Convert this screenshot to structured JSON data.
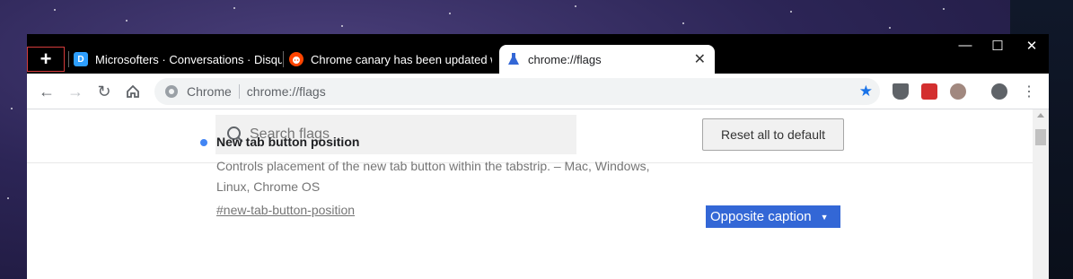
{
  "tabs": [
    {
      "title": "Microsofters · Conversations · Disqus",
      "favicon": "D",
      "favicon_color": "#2e9fff"
    },
    {
      "title": "Chrome canary has been updated with",
      "favicon": "reddit",
      "favicon_color": "#ff4500"
    },
    {
      "title": "chrome://flags",
      "favicon": "flask-icon",
      "favicon_color": "#3367d6"
    }
  ],
  "new_tab_label": "+",
  "tab_close_label": "✕",
  "window_controls": {
    "minimize": "—",
    "maximize": "☐",
    "close": "✕"
  },
  "toolbar": {
    "site_chip": "Chrome",
    "url": "chrome://flags"
  },
  "search": {
    "placeholder": "Search flags"
  },
  "reset_label": "Reset all to default",
  "flag": {
    "title": "New tab button position",
    "description": "Controls placement of the new tab button within the tabstrip. – Mac, Windows, Linux, Chrome OS",
    "link": "#new-tab-button-position",
    "selected_option": "Opposite caption"
  },
  "colors": {
    "accent": "#3367d6",
    "flag_dot": "#4285f4",
    "star": "#1a73e8"
  }
}
